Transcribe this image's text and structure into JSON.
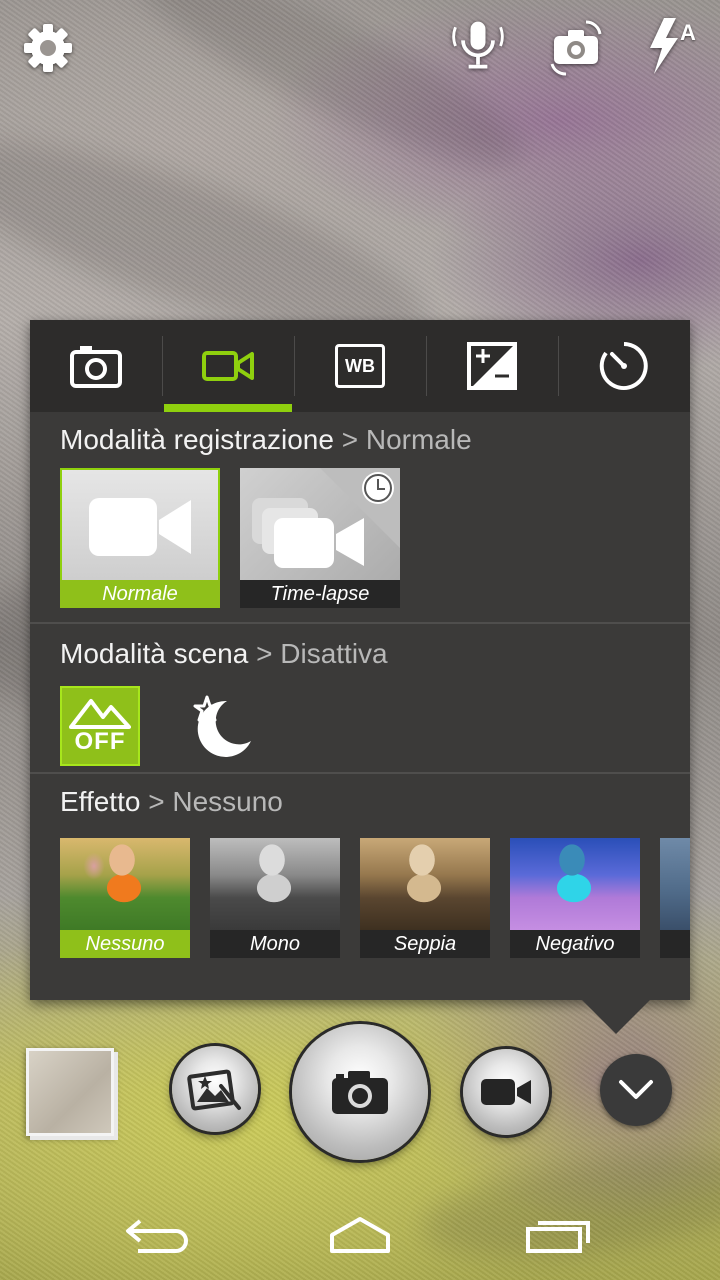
{
  "top_bar": {
    "settings_icon": "gear-icon",
    "voice_icon": "microphone-icon",
    "switch_camera_icon": "switch-camera-icon",
    "flash_icon": "flash-auto-icon",
    "flash_mode": "A"
  },
  "panel": {
    "tabs": [
      {
        "icon": "camera-icon",
        "active": false
      },
      {
        "icon": "video-camera-icon",
        "active": true
      },
      {
        "icon": "white-balance-icon",
        "label": "WB",
        "active": false
      },
      {
        "icon": "exposure-icon",
        "active": false
      },
      {
        "icon": "timer-icon",
        "active": false
      }
    ],
    "recording_mode": {
      "title": "Modalità registrazione",
      "separator": ">",
      "value": "Normale",
      "options": [
        {
          "label": "Normale",
          "selected": true
        },
        {
          "label": "Time-lapse",
          "selected": false
        }
      ]
    },
    "scene_mode": {
      "title": "Modalità scena",
      "separator": ">",
      "value": "Disattiva",
      "options": [
        {
          "icon": "scene-off-icon",
          "label": "OFF",
          "selected": true
        },
        {
          "icon": "night-moon-icon",
          "selected": false
        }
      ]
    },
    "effect": {
      "title": "Effetto",
      "separator": ">",
      "value": "Nessuno",
      "options": [
        {
          "label": "Nessuno",
          "selected": true
        },
        {
          "label": "Mono",
          "selected": false
        },
        {
          "label": "Seppia",
          "selected": false
        },
        {
          "label": "Negativo",
          "selected": false
        }
      ]
    }
  },
  "bottom_bar": {
    "gallery_thumbnail": "gallery-thumbnail",
    "effects_button_icon": "photo-effects-icon",
    "shutter_icon": "camera-icon",
    "record_icon": "video-camera-icon",
    "collapse_icon": "chevron-down-icon"
  },
  "nav_bar": {
    "back_icon": "back-icon",
    "home_icon": "home-icon",
    "recents_icon": "recents-icon"
  },
  "colors": {
    "accent": "#8fd00e",
    "panel": "#3b3a39",
    "tab_bar": "#2d2c2b"
  }
}
